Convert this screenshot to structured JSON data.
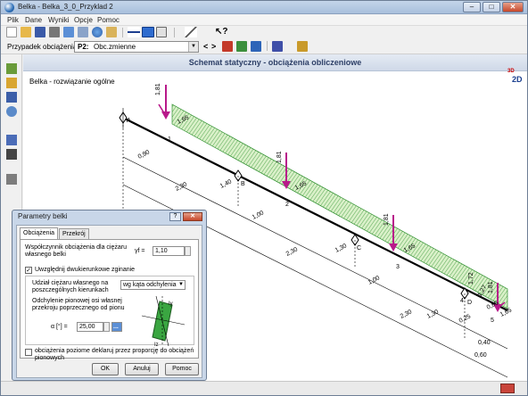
{
  "window": {
    "title": "Belka - Belka_3_0_Przyklad 2",
    "min": "–",
    "max": "□",
    "close": "✕"
  },
  "menu": [
    "Plik",
    "Dane",
    "Wyniki",
    "Opcje",
    "Pomoc"
  ],
  "case_bar": {
    "label": "Przypadek obciążenia",
    "code": "P2:",
    "name": "Obc.zmienne"
  },
  "canvas": {
    "title": "Schemat statyczny - obciążenia obliczeniowe",
    "subtitle": "Belka - rozwiązanie ogólne",
    "view3d": "3D",
    "view2d": "2D"
  },
  "beam": {
    "supports": [
      "A",
      "B",
      "C",
      "D"
    ],
    "nodes": [
      "1",
      "2",
      "3",
      "4",
      "5"
    ],
    "loads": [
      "1,81",
      "1,81",
      "1,81",
      "1,81"
    ],
    "distributed": [
      "1,65",
      "1,65",
      "1,65",
      "1,65"
    ],
    "distributed_extra": [
      "1,72",
      "1,27",
      "0,85"
    ],
    "dims_lower": [
      "0,90",
      "2,30",
      "1,00",
      "2,30",
      "1,00",
      "2,30",
      "1,30",
      "0,25"
    ],
    "dims_upper": [
      "1,40",
      "1,30"
    ],
    "dims_right": [
      "0,40",
      "0,60"
    ]
  },
  "dialog": {
    "title": "Parametry belki",
    "help": "?",
    "close": "✕",
    "tabs": [
      "Obciążenia",
      "Przekrój"
    ],
    "self_weight": {
      "label": "Współczynnik obciążenia dla ciężaru własnego belki",
      "symbol": "γf =",
      "value": "1,10"
    },
    "biaxial": {
      "label": "Uwzględnij dwukierunkowe zginanie",
      "checked": "✓"
    },
    "share": {
      "label": "Udział ciężaru własnego na poszczególnych kierunkach",
      "selected": "wg kąta odchylenia"
    },
    "deviation": {
      "label": "Odchylenie pionowej osi własnej przekroju poprzecznego od pionu",
      "symbol": "α [°] =",
      "value": "25,00",
      "more": "..."
    },
    "section_axes": {
      "y": "Iy",
      "z": "Iz"
    },
    "horizontal": {
      "label": "obciążenia poziome deklaruj przez proporcję do obciążeń pionowych",
      "checked": ""
    },
    "buttons": {
      "ok": "OK",
      "cancel": "Anuluj",
      "help": "Pomoc"
    }
  },
  "colors": {
    "load": "#b8198a",
    "distributed": "#2f8f2f",
    "accent": "#2c3e66"
  }
}
